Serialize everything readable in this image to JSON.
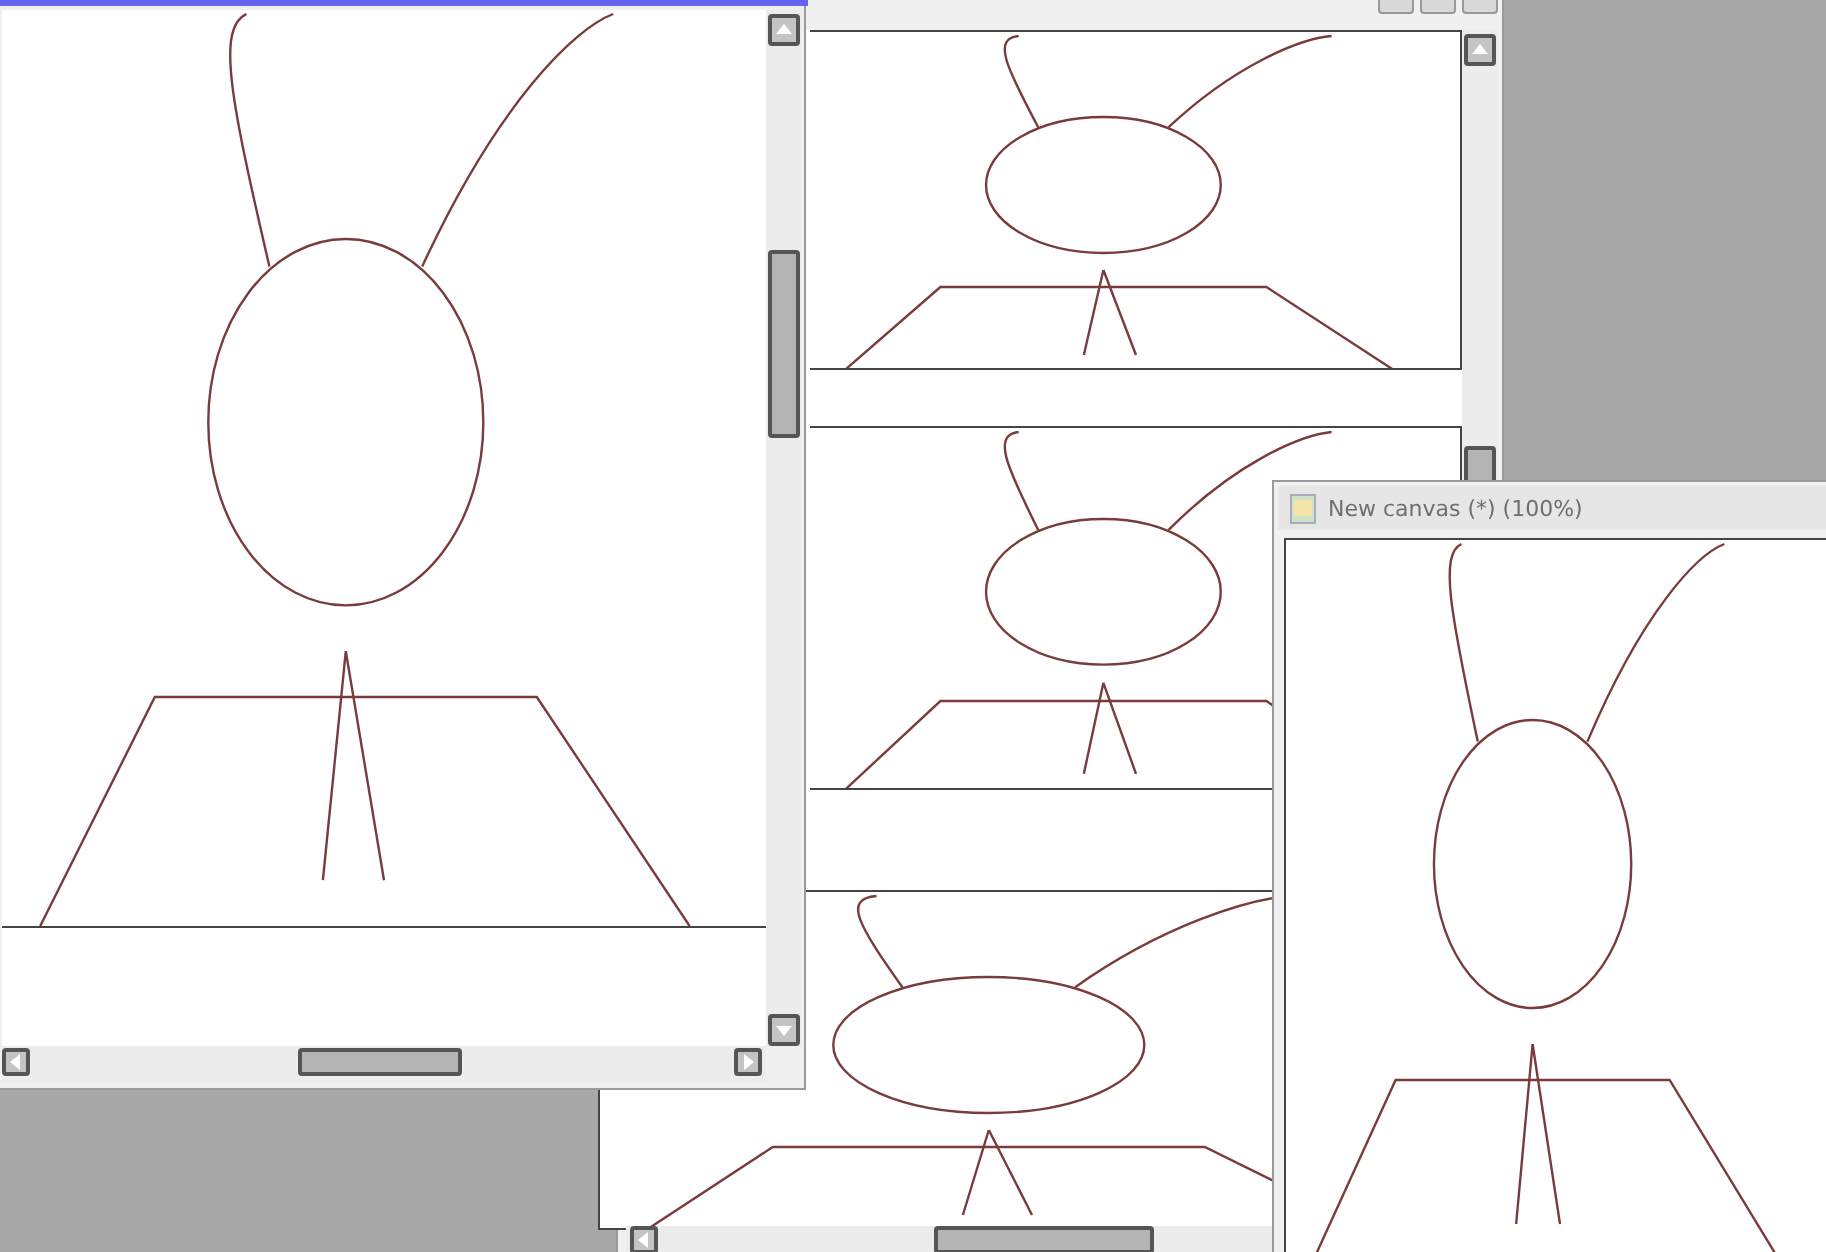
{
  "canvas_window": {
    "title": "New canvas (*) (100%)"
  }
}
